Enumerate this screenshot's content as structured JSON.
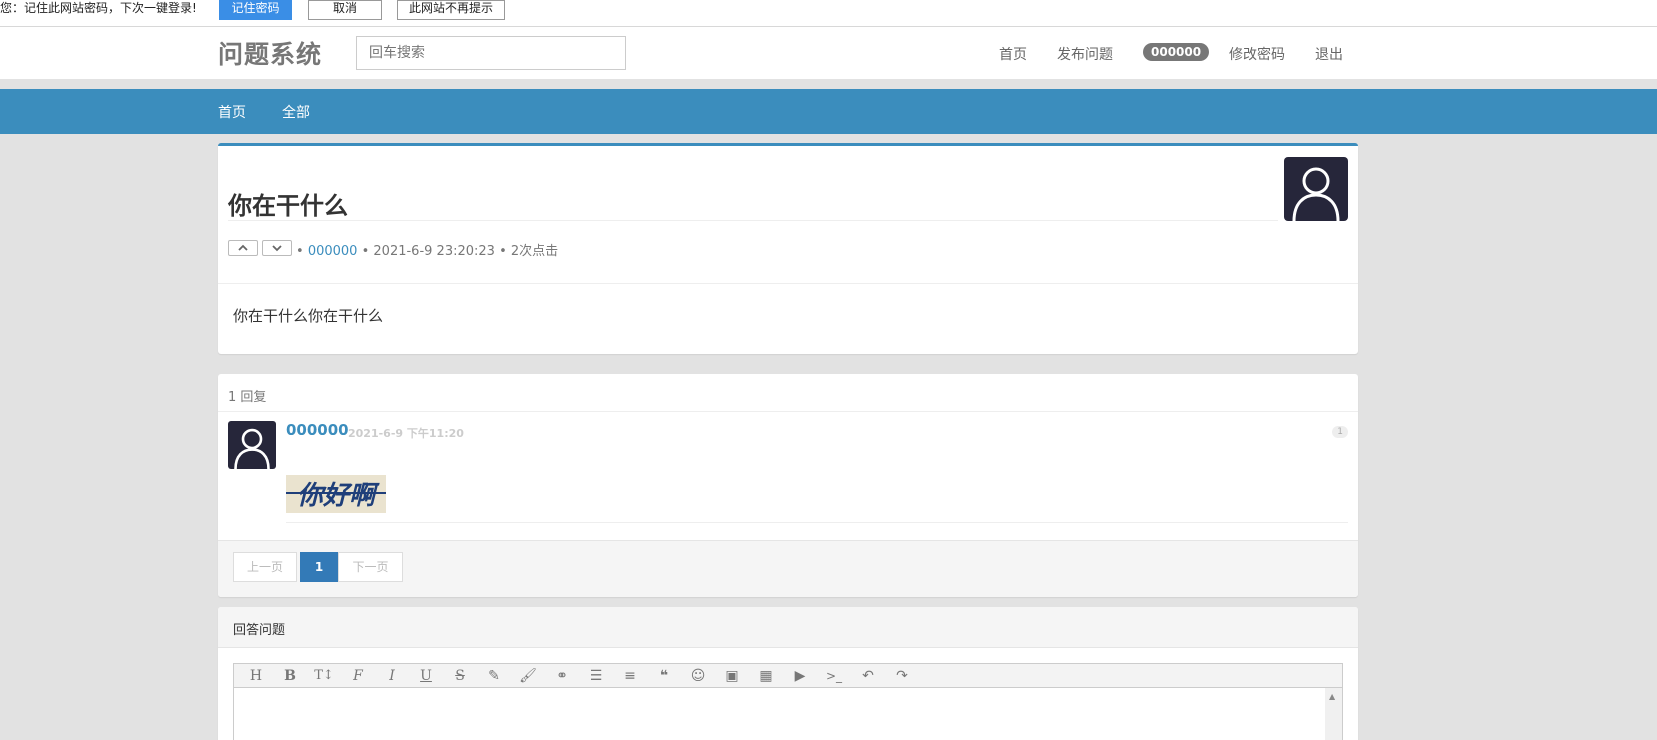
{
  "password_bar": {
    "message": "您：记住此网站密码，下次一键登录!",
    "remember_label": "记住密码",
    "cancel_label": "取消",
    "never_label": "此网站不再提示"
  },
  "header": {
    "logo": "问题系统",
    "search_placeholder": "回车搜索",
    "nav": {
      "home": "首页",
      "post": "发布问题",
      "user": "000000",
      "password": "修改密码",
      "logout": "退出"
    }
  },
  "subnav": {
    "home": "首页",
    "all": "全部"
  },
  "question": {
    "title": "你在干什么",
    "author": "000000",
    "datetime": "2021-6-9 23:20:23",
    "clicks": "2次点击",
    "bullet": "•",
    "body": "你在干什么你在干什么"
  },
  "replies": {
    "count_label": "1 回复",
    "items": [
      {
        "user": "000000",
        "time": "2021-6-9 下午11:20",
        "floor": "1",
        "image_text": "你好啊"
      }
    ],
    "pagination": {
      "prev": "上一页",
      "current": "1",
      "next": "下一页"
    }
  },
  "answer": {
    "title": "回答问题",
    "toolbar": [
      "heading-icon",
      "bold-icon",
      "text-height-icon",
      "font-icon",
      "italic-icon",
      "underline-icon",
      "strikethrough-icon",
      "eraser-icon",
      "brush-icon",
      "link-icon",
      "list-ul-icon",
      "align-left-icon",
      "quote-icon",
      "emoji-icon",
      "image-icon",
      "table-icon",
      "video-icon",
      "code-icon",
      "undo-icon",
      "redo-icon"
    ]
  },
  "colors": {
    "accent": "#3b8dbd",
    "primary_button": "#3a8ee6",
    "avatar_bg": "#26263a",
    "page_bg": "#e2e2e2"
  }
}
